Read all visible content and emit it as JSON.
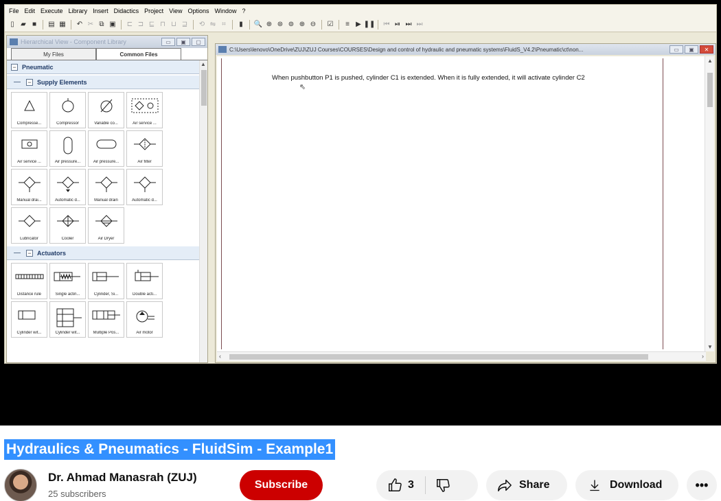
{
  "app": {
    "menu": [
      "File",
      "Edit",
      "Execute",
      "Library",
      "Insert",
      "Didactics",
      "Project",
      "View",
      "Options",
      "Window",
      "?"
    ],
    "library_panel": {
      "title": "Hierarchical View - Component Library",
      "tabs": [
        "My Files",
        "Common Files"
      ],
      "root_group": "Pneumatic",
      "groups": [
        {
          "name": "Supply Elements",
          "items": [
            "Compresse...",
            "Compressor",
            "Variable co...",
            "Air service ...",
            "Air service ...",
            "Air pressure...",
            "Air pressure...",
            "Air filter",
            "Manual drai...",
            "Automatic d...",
            "Manual drain",
            "Automatic d...",
            "Lubricator",
            "Cooler",
            "Air Dryer"
          ]
        },
        {
          "name": "Actuators",
          "items": [
            "Distance rule",
            "Single actin...",
            "Cylinder, Si...",
            "Double acti...",
            "Cylinder wit...",
            "Cylinder wit...",
            "Multiple Pos...",
            "Air motor"
          ]
        }
      ]
    },
    "document": {
      "title": "C:\\Users\\lenovo\\OneDrive\\ZUJ\\ZUJ Courses\\COURSES\\Design and control of hydraulic and pneumatic systems\\FluidS_V4.2\\Pneumatic\\ct\\non...",
      "text": "When pushbutton P1 is pushed, cylinder C1 is extended. When it is fully extended, it will activate cylinder C2"
    }
  },
  "video": {
    "title": "Hydraulics & Pneumatics - FluidSim - Example1",
    "channel": "Dr. Ahmad Manasrah (ZUJ)",
    "subscribers": "25 subscribers",
    "subscribe_label": "Subscribe",
    "likes": "3",
    "share_label": "Share",
    "download_label": "Download"
  },
  "colors": {
    "subscribe": "#cc0000",
    "title_highlight": "#3390ff",
    "library_group_bg": "#e4edf7"
  }
}
